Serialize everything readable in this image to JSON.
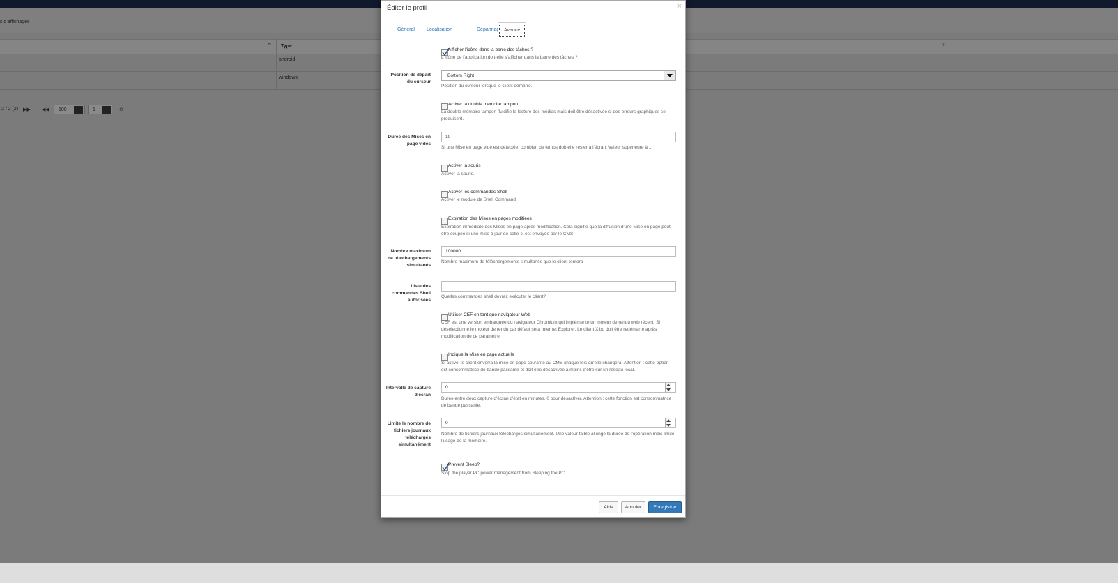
{
  "background": {
    "breadcrumb": "s d'affichages",
    "table": {
      "type_header": "Type",
      "rows": [
        {
          "type": "android"
        },
        {
          "type": "windows"
        }
      ]
    },
    "pager": {
      "info": "2 / 2 (2)",
      "page_size": "100",
      "page": "1"
    }
  },
  "modal": {
    "title": "Éditer le profil",
    "close": "×",
    "tabs": [
      {
        "label": "Général"
      },
      {
        "label": "Localisation"
      },
      {
        "label": "Dépannage"
      },
      {
        "label": "Avancé",
        "active": true
      }
    ],
    "fields": {
      "show_icon": {
        "label": "Afficher l'icône dans la barre des tâches ?",
        "help": "L'icône de l'application doit-elle s'afficher dans la barre des tâches ?",
        "checked": true
      },
      "cursor_start": {
        "label": "Position de départ du curseur",
        "value": "Bottom Right",
        "help": "Position du curseur lorsque le client démarre."
      },
      "double_buffer": {
        "label": "Activer la double mémoire tampon",
        "help": "La double mémoire tampon fluidifie la lecture des médias mais doit être désactivée si des erreurs graphiques se produisent.",
        "checked": false
      },
      "empty_layout_duration": {
        "label": "Durée des Mises en page vides",
        "value": "10",
        "help": "Si une Mise en page vide est détectée, combien de temps doit-elle rester à l'écran. Valeur supérieure à 1."
      },
      "enable_mouse": {
        "label": "Activer la souris",
        "help": "Activer la souris.",
        "checked": false
      },
      "shell_commands": {
        "label": "Activer les commandes Shell",
        "help": "Activer le module de Shell Command",
        "checked": false
      },
      "expire_layouts": {
        "label": "Expiration des Mises en pages modifiées",
        "help": "Expiration immédiate des Mises en page après modification. Cela signifie que la diffusion d'une Mise en page peut être coupée si une mise à jour de celle-ci est envoyée par le CMS",
        "checked": false
      },
      "max_downloads": {
        "label": "Nombre maximum de téléchargements simultanés",
        "value": "100000",
        "help": "Nombre maximum de téléchargements simultanés que le client tentera"
      },
      "allowed_shell": {
        "label": "Liste des commandes Shell autorisées",
        "value": "",
        "help": "Quelles commandes shell devrait exécuter le client?"
      },
      "use_cef": {
        "label": "Utiliser CEF en tant que navigateur Web",
        "help": "CEF est une version embarquée du navigateur Chromium qui implémente un moteur de rendu web récent. Si désélectionné le moteur de rendu par défaut sera Internet Explorer. Le client Xibo doit être redémarré après modification de ce paramètre.",
        "checked": false
      },
      "current_layout": {
        "label": "Indique la Mise en page actuelle",
        "help": "Si activé, le client enverra la mise en page courante au CMS chaque fois qu'elle changera. Attention : cette option est consommatrice de bande passante et doit être désactivée à moins d'être sur un réseau local.",
        "checked": false
      },
      "screenshot_interval": {
        "label": "Intervalle de capture d'écran",
        "value": "0",
        "help": "Durée entre deux capture d'écran d'état en minutes. 0 pour désactiver. Attention : cette fonction est consommatrice de bande passante."
      },
      "log_file_limit": {
        "label": "Limite le nombre de fichiers journaux téléchargés simultanément",
        "value": "0",
        "help": "Nombre de fichiers journaux téléchargés simultanément. Une valeur faible allonge la durée de l'opération mais limite l'usage de la mémoire."
      },
      "prevent_sleep": {
        "label": "Prevent Sleep?",
        "help": "Stop the player PC power management from Sleeping the PC",
        "checked": true
      }
    },
    "buttons": {
      "help": "Aide",
      "cancel": "Annuler",
      "save": "Enregistrer"
    }
  }
}
